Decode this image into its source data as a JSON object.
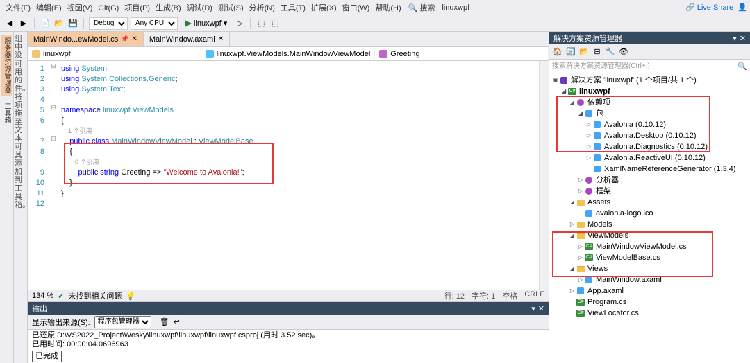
{
  "menubar": [
    "文件(F)",
    "编辑(E)",
    "视图(V)",
    "Git(G)",
    "项目(P)",
    "生成(B)",
    "调试(D)",
    "测试(S)",
    "分析(N)",
    "工具(T)",
    "扩展(X)",
    "窗口(W)",
    "帮助(H)"
  ],
  "menubar_search_placeholder": "搜索",
  "menubar_project_name": "linuxwpf",
  "live_share": "Live Share",
  "toolbar": {
    "config": "Debug",
    "platform": "Any CPU",
    "run_target": "linuxwpf"
  },
  "left_tabs": [
    "服务器资源管理器",
    "工具箱"
  ],
  "left_side_text": [
    "组中没",
    "可用的",
    "件。将",
    "项拖至",
    "文本可",
    "其添加",
    "到工具",
    "箱。"
  ],
  "tabs": [
    {
      "label": "MainWindo...ewModel.cs",
      "active": true
    },
    {
      "label": "MainWindow.axaml",
      "active": false
    }
  ],
  "nav_bar": [
    "linuxwpf",
    "linuxwpf.ViewModels.MainWindowViewModel",
    "Greeting"
  ],
  "code_lines": [
    {
      "n": 1,
      "tokens": [
        {
          "cls": "kw",
          "t": "using "
        },
        {
          "cls": "ns",
          "t": "System"
        },
        {
          "cls": "",
          "t": ";"
        }
      ]
    },
    {
      "n": 2,
      "tokens": [
        {
          "cls": "kw",
          "t": "using "
        },
        {
          "cls": "ns",
          "t": "System.Collections.Generic"
        },
        {
          "cls": "",
          "t": ";"
        }
      ]
    },
    {
      "n": 3,
      "tokens": [
        {
          "cls": "kw",
          "t": "using "
        },
        {
          "cls": "ns",
          "t": "System.Text"
        },
        {
          "cls": "",
          "t": ";"
        }
      ]
    },
    {
      "n": 4,
      "tokens": []
    },
    {
      "n": 5,
      "tokens": [
        {
          "cls": "kw",
          "t": "namespace "
        },
        {
          "cls": "ns",
          "t": "linuxwpf.ViewModels"
        }
      ]
    },
    {
      "n": 6,
      "tokens": [
        {
          "cls": "",
          "t": "{"
        }
      ]
    },
    {
      "n": "",
      "tokens": [
        {
          "cls": "com-hint",
          "t": "    1 个引用"
        }
      ]
    },
    {
      "n": 7,
      "tokens": [
        {
          "cls": "",
          "t": "    "
        },
        {
          "cls": "kw",
          "t": "public class "
        },
        {
          "cls": "cls",
          "t": "MainWindowViewModel"
        },
        {
          "cls": "",
          "t": " : "
        },
        {
          "cls": "cls",
          "t": "ViewModelBase"
        }
      ]
    },
    {
      "n": 8,
      "tokens": [
        {
          "cls": "",
          "t": "    {"
        }
      ]
    },
    {
      "n": "",
      "tokens": [
        {
          "cls": "com-hint",
          "t": "        0 个引用"
        }
      ]
    },
    {
      "n": 9,
      "tokens": [
        {
          "cls": "",
          "t": "        "
        },
        {
          "cls": "kw",
          "t": "public string "
        },
        {
          "cls": "",
          "t": "Greeting => "
        },
        {
          "cls": "str",
          "t": "\"Welcome to Avalonia!\""
        },
        {
          "cls": "",
          "t": ";"
        }
      ]
    },
    {
      "n": 10,
      "tokens": [
        {
          "cls": "",
          "t": "    }"
        }
      ]
    },
    {
      "n": 11,
      "tokens": [
        {
          "cls": "",
          "t": "}"
        }
      ]
    },
    {
      "n": 12,
      "tokens": []
    }
  ],
  "zoom": "134 %",
  "no_issue": "未找到相关问题",
  "status_right": {
    "line": "行: 12",
    "col": "字符: 1",
    "space": "空格",
    "eol": "CRLF"
  },
  "output_panel_title": "输出",
  "output_source_label": "显示输出来源(S):",
  "output_source": "程序包管理器",
  "output_lines": [
    "已还原 D:\\VS2022_Project\\Wesky\\linuxwpf\\linuxwpf\\linuxwpf.csproj (用时 3.52 sec)。",
    "已用时间: 00:00:04.0696963"
  ],
  "output_final": "已完成",
  "solution_panel_title": "解决方案资源管理器",
  "sln_search_placeholder": "搜索解决方案资源管理器(Ctrl+;)",
  "tree": [
    {
      "depth": 0,
      "expand": "▣",
      "icon": "sln",
      "label": "解决方案 'linuxwpf' (1 个项目/共 1 个)"
    },
    {
      "depth": 1,
      "expand": "◢",
      "icon": "cs",
      "label": "linuxwpf",
      "bold": true
    },
    {
      "depth": 2,
      "expand": "◢",
      "icon": "conn",
      "label": "依赖项"
    },
    {
      "depth": 3,
      "expand": "◢",
      "icon": "pkg",
      "label": "包"
    },
    {
      "depth": 4,
      "expand": "▷",
      "icon": "pkg",
      "label": "Avalonia (0.10.12)"
    },
    {
      "depth": 4,
      "expand": "▷",
      "icon": "pkg",
      "label": "Avalonia.Desktop (0.10.12)"
    },
    {
      "depth": 4,
      "expand": "▷",
      "icon": "pkg",
      "label": "Avalonia.Diagnostics (0.10.12)"
    },
    {
      "depth": 4,
      "expand": "▷",
      "icon": "pkg",
      "label": "Avalonia.ReactiveUI (0.10.12)"
    },
    {
      "depth": 4,
      "expand": "",
      "icon": "pkg",
      "label": "XamlNameReferenceGenerator (1.3.4)"
    },
    {
      "depth": 3,
      "expand": "▷",
      "icon": "conn",
      "label": "分析器"
    },
    {
      "depth": 3,
      "expand": "▷",
      "icon": "conn",
      "label": "框架"
    },
    {
      "depth": 2,
      "expand": "◢",
      "icon": "folder",
      "label": "Assets"
    },
    {
      "depth": 3,
      "expand": "",
      "icon": "pkg",
      "label": "avalonia-logo.ico"
    },
    {
      "depth": 2,
      "expand": "▷",
      "icon": "folder",
      "label": "Models"
    },
    {
      "depth": 2,
      "expand": "◢",
      "icon": "folder-open",
      "label": "ViewModels"
    },
    {
      "depth": 3,
      "expand": "▷",
      "icon": "cs",
      "label": "MainWindowViewModel.cs"
    },
    {
      "depth": 3,
      "expand": "▷",
      "icon": "cs",
      "label": "ViewModelBase.cs"
    },
    {
      "depth": 2,
      "expand": "◢",
      "icon": "folder-open",
      "label": "Views"
    },
    {
      "depth": 3,
      "expand": "▷",
      "icon": "pkg",
      "label": "MainWindow.axaml"
    },
    {
      "depth": 2,
      "expand": "▷",
      "icon": "pkg",
      "label": "App.axaml"
    },
    {
      "depth": 2,
      "expand": "",
      "icon": "cs",
      "label": "Program.cs"
    },
    {
      "depth": 2,
      "expand": "",
      "icon": "cs",
      "label": "ViewLocator.cs"
    }
  ]
}
